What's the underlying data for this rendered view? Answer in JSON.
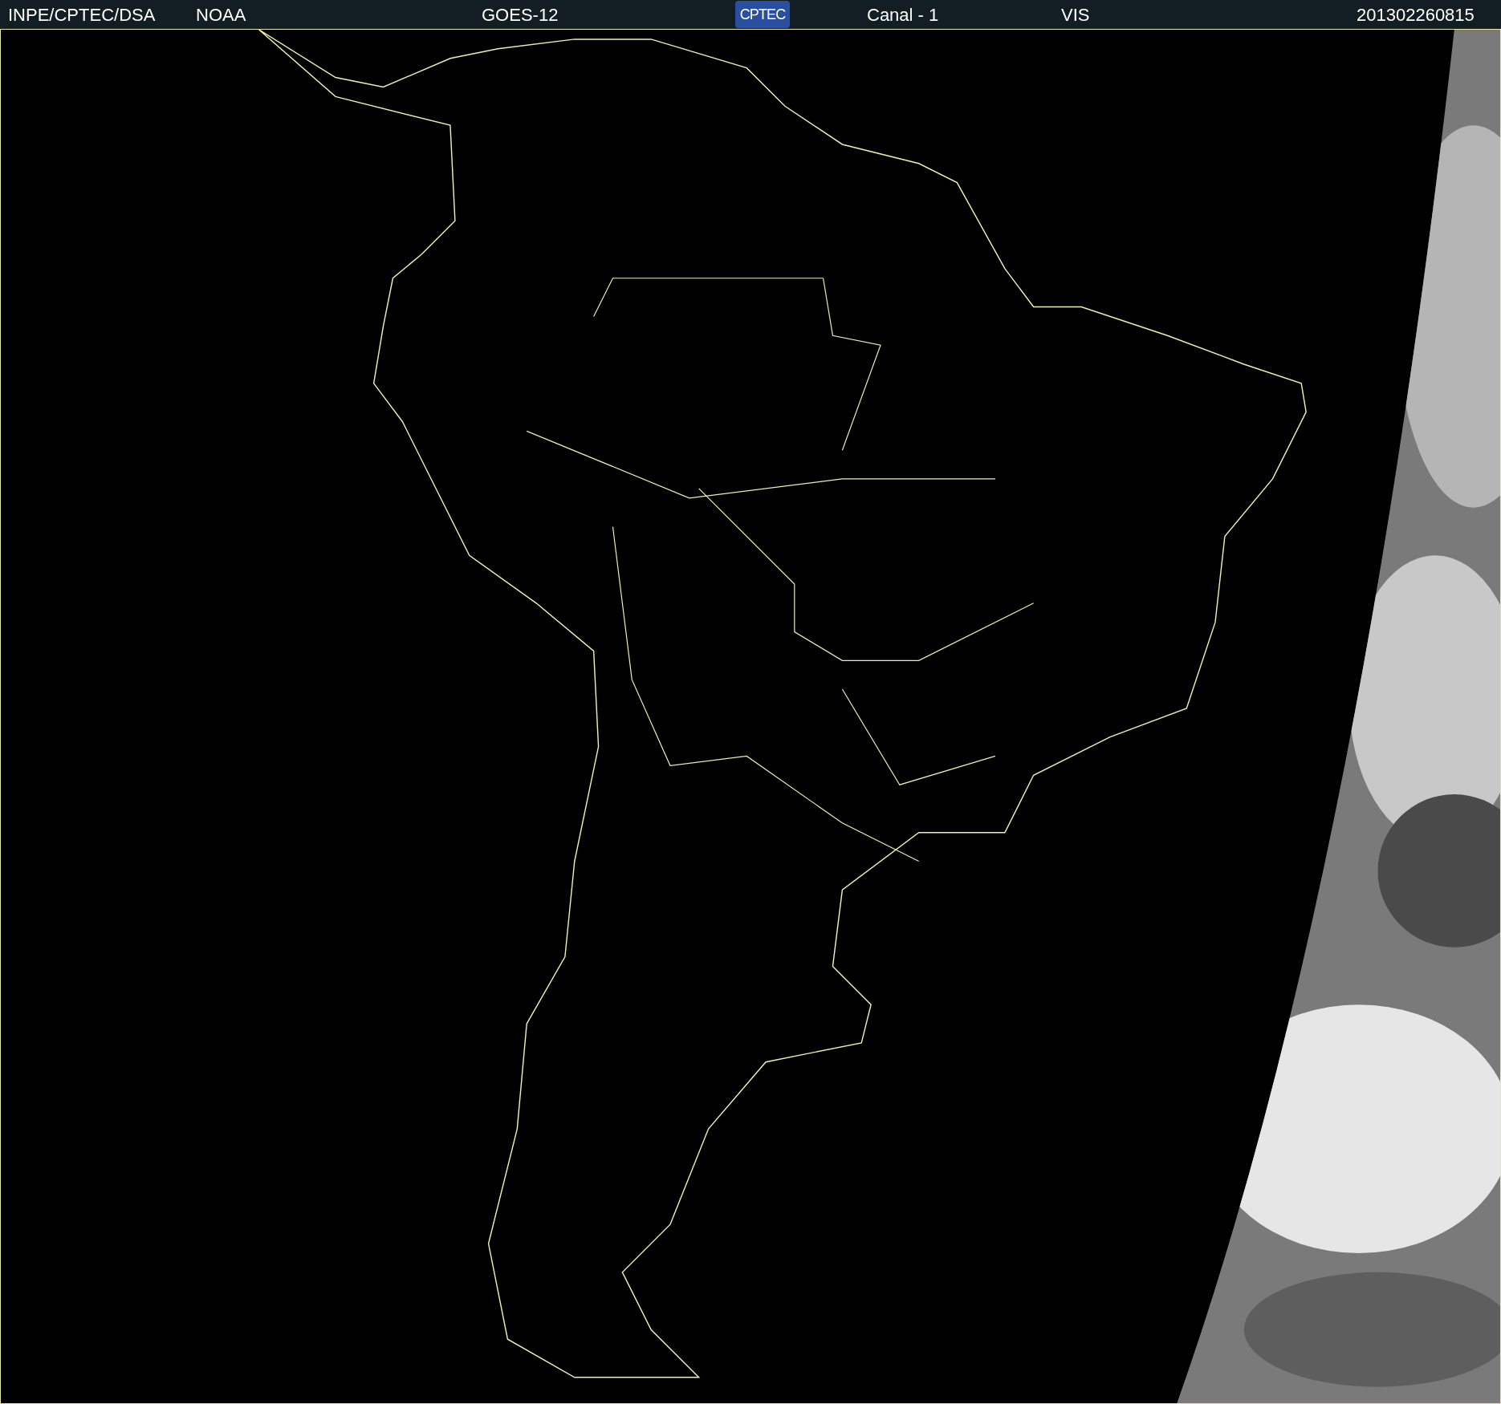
{
  "header": {
    "items": [
      {
        "kind": "text",
        "text": "INPE/CPTEC/DSA"
      },
      {
        "kind": "text",
        "text": "NOAA"
      },
      {
        "kind": "text",
        "text": "GOES-12"
      },
      {
        "kind": "logo",
        "text": "CPTEC"
      },
      {
        "kind": "text",
        "text": "Canal - 1"
      },
      {
        "kind": "text",
        "text": "VIS"
      },
      {
        "kind": "text",
        "text": "201302260815"
      }
    ]
  }
}
